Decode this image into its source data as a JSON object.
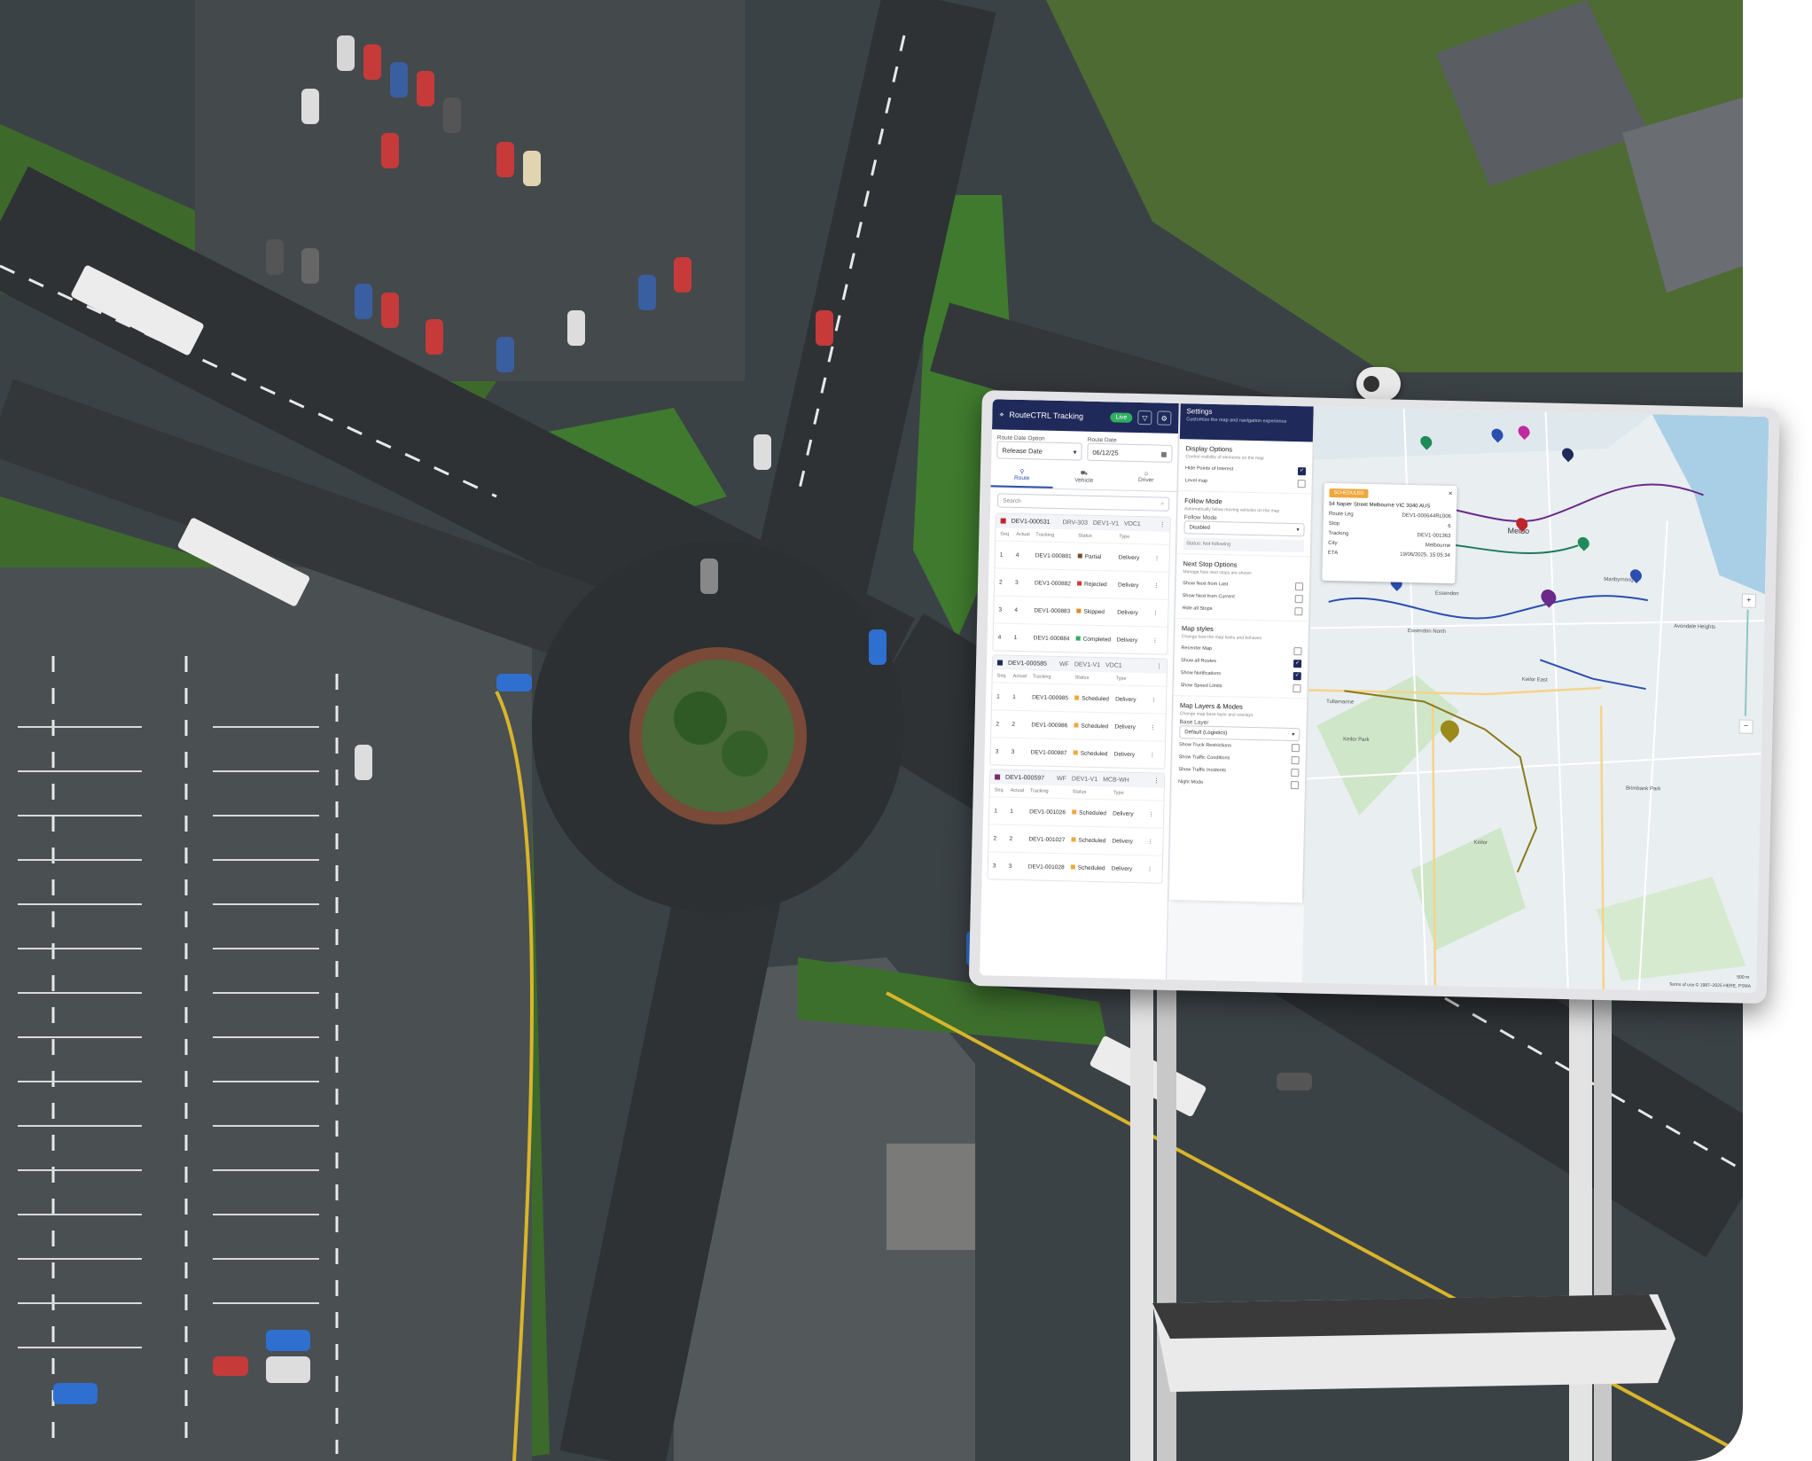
{
  "app": {
    "title": "RouteCTRL Tracking",
    "live_label": "Live"
  },
  "filters": {
    "route_date_option_label": "Route Date Option",
    "route_date_option_value": "Release Date",
    "route_date_label": "Route Date",
    "route_date_value": "06/12/25"
  },
  "tabs": [
    {
      "label": "Route"
    },
    {
      "label": "Vehicle"
    },
    {
      "label": "Driver"
    }
  ],
  "search": {
    "placeholder": "Search"
  },
  "columns": {
    "seq": "Seq",
    "actual": "Actual",
    "tracking": "Tracking",
    "status": "Status",
    "type": "Type"
  },
  "routes": [
    {
      "id": "DEV1-000531",
      "a": "DRV-303",
      "b": "DEV1-V1",
      "c": "VDC1",
      "color": "#c0242c",
      "stops": [
        {
          "seq": "1",
          "actual": "4",
          "tracking": "DEV1-000881",
          "status": "Partial",
          "status_color": "#7b4a2a",
          "type": "Delivery"
        },
        {
          "seq": "2",
          "actual": "3",
          "tracking": "DEV1-000882",
          "status": "Rejected",
          "status_color": "#d33a3a",
          "type": "Delivery"
        },
        {
          "seq": "3",
          "actual": "4",
          "tracking": "DEV1-000883",
          "status": "Skipped",
          "status_color": "#e08a2a",
          "type": "Delivery"
        },
        {
          "seq": "4",
          "actual": "1",
          "tracking": "DEV1-000884",
          "status": "Completed",
          "status_color": "#2fae62",
          "type": "Delivery"
        }
      ]
    },
    {
      "id": "DEV1-000585",
      "a": "WF",
      "b": "DEV1-V1",
      "c": "VDC1",
      "color": "#1f2a5a",
      "stops": [
        {
          "seq": "1",
          "actual": "1",
          "tracking": "DEV1-000985",
          "status": "Scheduled",
          "status_color": "#f0a83c",
          "type": "Delivery"
        },
        {
          "seq": "2",
          "actual": "2",
          "tracking": "DEV1-000986",
          "status": "Scheduled",
          "status_color": "#f0a83c",
          "type": "Delivery"
        },
        {
          "seq": "3",
          "actual": "3",
          "tracking": "DEV1-000987",
          "status": "Scheduled",
          "status_color": "#f0a83c",
          "type": "Delivery"
        }
      ]
    },
    {
      "id": "DEV1-000597",
      "a": "WF",
      "b": "DEV1-V1",
      "c": "MCB-WH",
      "color": "#7a2a6a",
      "stops": [
        {
          "seq": "1",
          "actual": "1",
          "tracking": "DEV1-001026",
          "status": "Scheduled",
          "status_color": "#f0a83c",
          "type": "Delivery"
        },
        {
          "seq": "2",
          "actual": "2",
          "tracking": "DEV1-001027",
          "status": "Scheduled",
          "status_color": "#f0a83c",
          "type": "Delivery"
        },
        {
          "seq": "3",
          "actual": "3",
          "tracking": "DEV1-001028",
          "status": "Scheduled",
          "status_color": "#f0a83c",
          "type": "Delivery"
        }
      ]
    }
  ],
  "settings": {
    "title": "Settings",
    "subtitle": "Customize the map and navigation experience",
    "display": {
      "title": "Display Options",
      "desc": "Control visibility of elements on the map",
      "hide_poi": "Hide Points of Interest",
      "level_map": "Level map"
    },
    "follow": {
      "title": "Follow Mode",
      "desc": "Automatically follow moving vehicles on the map",
      "mode_label": "Follow Mode",
      "mode_value": "Disabled",
      "status": "Status: Not following"
    },
    "next_stop": {
      "title": "Next Stop Options",
      "desc": "Manage how next stops are shown",
      "from_last": "Show Next from Last",
      "from_current": "Show Next from Current",
      "hide_all": "Hide all Stops"
    },
    "styles": {
      "title": "Map styles",
      "desc": "Change how the map looks and behaves",
      "recenter": "Recenter Map",
      "all_routes": "Show all Routes",
      "notifications": "Show Notifications",
      "speed": "Show Speed Limits"
    },
    "layers": {
      "title": "Map Layers & Modes",
      "desc": "Change map base layer and overlays",
      "base_label": "Base Layer",
      "base_value": "Default (Logistics)",
      "truck": "Show Truck Restrictions",
      "traffic": "Show Traffic Conditions",
      "incidents": "Show Traffic Incidents",
      "night": "Night Mode"
    }
  },
  "popup": {
    "badge": "SCHEDULED",
    "address": "54 Napier Street Melbourne VIC 3040 AUS",
    "route_leg_label": "Route Leg",
    "route_leg": "DEV1-000644RL006",
    "stop_label": "Stop",
    "stop": "6",
    "tracking_label": "Tracking",
    "tracking": "DEV1-001363",
    "city_label": "City",
    "city": "Melbourne",
    "eta_label": "ETA",
    "eta": "19/06/2025, 15:05:34"
  },
  "map": {
    "labels": [
      "Melbo",
      "Essendon",
      "Keilor East",
      "Tullamarine",
      "Keilor Park",
      "Keilor",
      "Avondale Heights",
      "Essendon North",
      "Brimbank Park",
      "Maribyrnong"
    ],
    "footer": "Terms of use  © 1987–2025 HERE, PSMA",
    "scale": "500 m"
  }
}
